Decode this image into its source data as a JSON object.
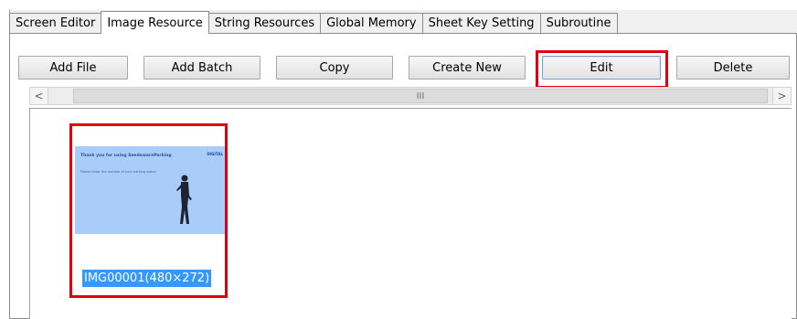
{
  "tabs": [
    {
      "label": "Screen Editor"
    },
    {
      "label": "Image Resource"
    },
    {
      "label": "String Resources"
    },
    {
      "label": "Global Memory"
    },
    {
      "label": "Sheet Key Setting"
    },
    {
      "label": "Subroutine"
    }
  ],
  "active_tab": "Image Resource",
  "toolbar": {
    "add_file": "Add File",
    "add_batch": "Add Batch",
    "copy": "Copy",
    "create_new": "Create New",
    "edit": "Edit",
    "delete": "Delete"
  },
  "scrollbar": {
    "left_arrow": "<",
    "right_arrow": ">",
    "thumb_grip": "III"
  },
  "image_list": [
    {
      "caption": "IMG00001(480×272)",
      "preview": {
        "title": "Thank you for using SeedewareParking",
        "body": "Please enter the number of your parking space",
        "logo": "DIGITAL"
      }
    }
  ],
  "colors": {
    "highlight": "#e0000f",
    "selection": "#3399ff",
    "preview_bg": "#a9cdf8"
  }
}
